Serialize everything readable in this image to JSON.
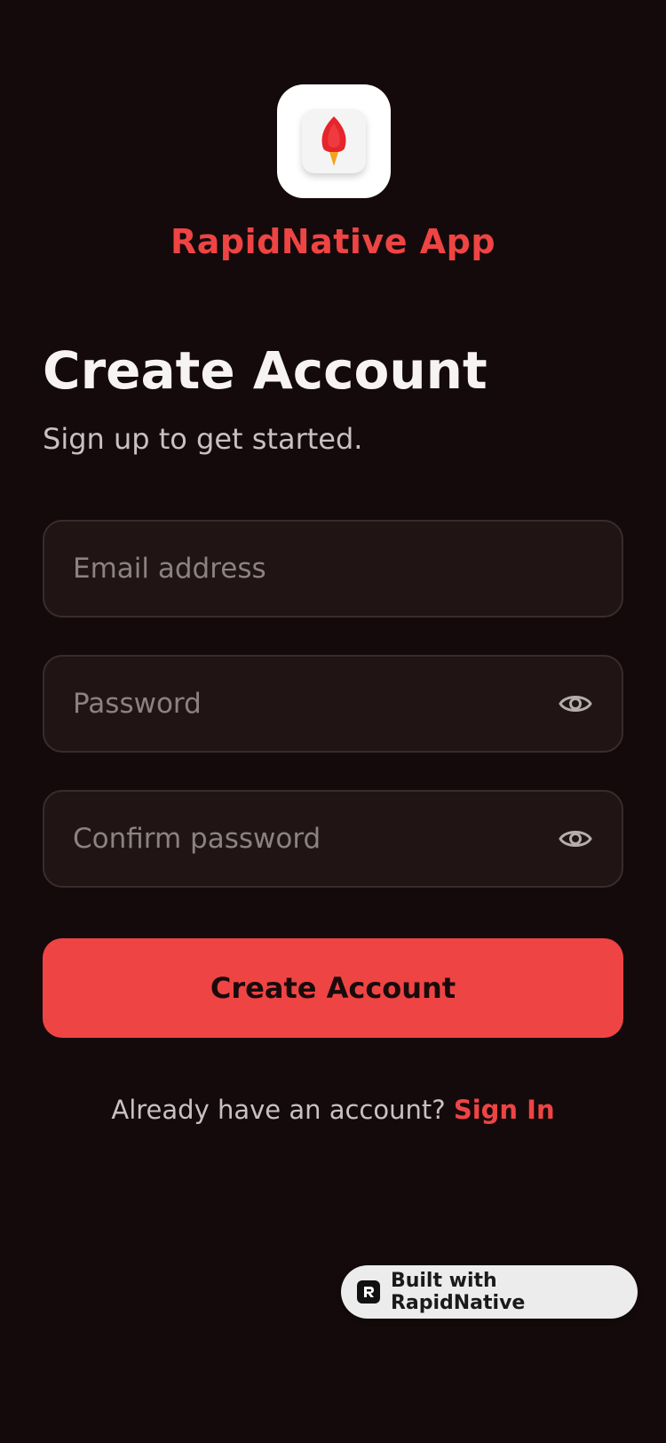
{
  "app": {
    "name": "RapidNative App",
    "logo_icon": "rocket-icon",
    "accent_color": "#ef4444"
  },
  "header": {
    "title": "Create Account",
    "subtitle": "Sign up to get started."
  },
  "form": {
    "email": {
      "placeholder": "Email address",
      "value": ""
    },
    "password": {
      "placeholder": "Password",
      "value": "",
      "toggle_icon": "eye-icon"
    },
    "confirm_password": {
      "placeholder": "Confirm password",
      "value": "",
      "toggle_icon": "eye-icon"
    },
    "submit_label": "Create Account"
  },
  "footer": {
    "prompt": "Already have an account?",
    "link_label": "Sign In"
  },
  "badge": {
    "label": "Built with RapidNative",
    "icon": "rapidnative-logo-icon"
  }
}
